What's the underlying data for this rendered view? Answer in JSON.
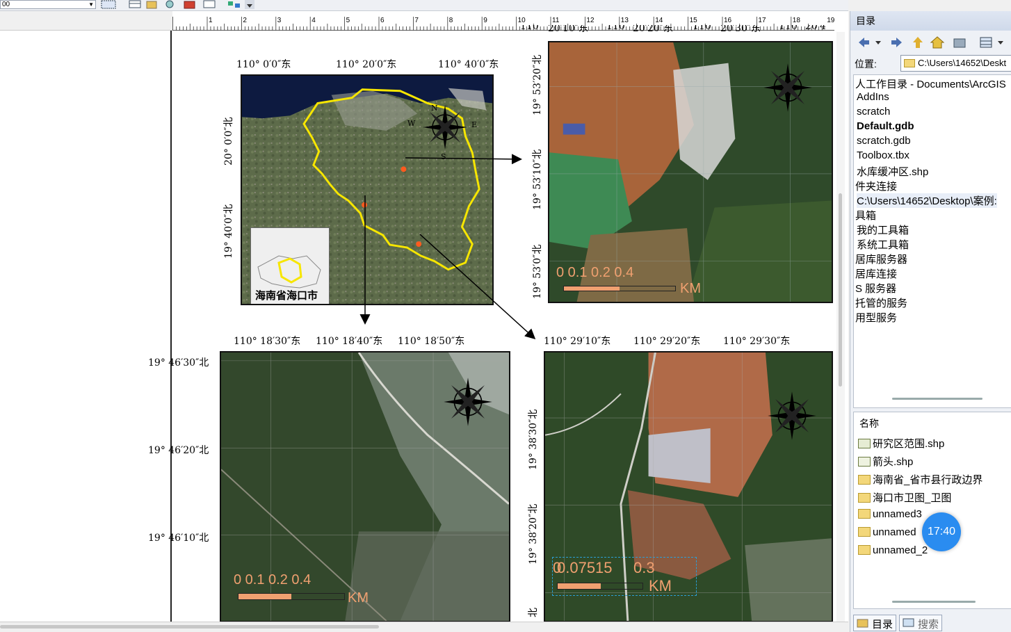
{
  "toolbar": {
    "zoom_value": "00"
  },
  "ruler": {
    "ticks": [
      "1",
      "2",
      "3",
      "4",
      "5",
      "6",
      "7",
      "8",
      "9",
      "10",
      "11",
      "12",
      "13",
      "14",
      "15",
      "16",
      "17",
      "18",
      "19"
    ]
  },
  "map_overview": {
    "top_labels": [
      "110° 0′0″东",
      "110° 20′0″东",
      "110° 40′0″东"
    ],
    "left_labels": [
      "20° 0′0″北",
      "19° 40′0″北"
    ],
    "inset_label": "海南省海口市",
    "compass": {
      "n": "N",
      "e": "E",
      "s": "S",
      "w": "W"
    }
  },
  "map_tr": {
    "top_labels": [
      "110",
      "20′10″东",
      "110",
      "20′20″东",
      "110",
      "20′30″东",
      "110",
      "20′4"
    ],
    "left_labels": [
      "19° 53′20″北",
      "19° 53′10″北",
      "19° 53′0″北"
    ],
    "scale_numbers": "0  0.1 0.2       0.4",
    "scale_unit": "KM"
  },
  "map_bl": {
    "top_labels": [
      "110° 18′30″东",
      "110° 18′40″东",
      "110° 18′50″东"
    ],
    "left_labels": [
      "19° 46′30″北",
      "19° 46′20″北",
      "19° 46′10″北"
    ],
    "scale_numbers": "0  0.1 0.2       0.4",
    "scale_unit": "KM"
  },
  "map_br": {
    "top_labels": [
      "110° 29′10″东",
      "110° 29′20″东",
      "110° 29′30″东"
    ],
    "left_labels": [
      "19° 38′30″北",
      "19° 38′20″北",
      "北"
    ],
    "scale_numbers": "0.07515",
    "scale_num_lead": "0",
    "scale_num_tail": "0.3",
    "scale_unit": "KM"
  },
  "catalog": {
    "title": "目录",
    "location_label": "位置:",
    "location_value": "C:\\Users\\14652\\Deskt",
    "tree_items": [
      {
        "label": "人工作目录 - Documents\\ArcGIS"
      },
      {
        "label": "AddIns"
      },
      {
        "label": "scratch"
      },
      {
        "label": "Default.gdb"
      },
      {
        "label": "scratch.gdb"
      },
      {
        "label": "Toolbox.tbx"
      },
      {
        "label": "水库缓冲区.shp"
      },
      {
        "label": "件夹连接"
      },
      {
        "label": "C:\\Users\\14652\\Desktop\\案例:"
      },
      {
        "label": "具箱"
      },
      {
        "label": "我的工具箱"
      },
      {
        "label": "系统工具箱"
      },
      {
        "label": "居库服务器"
      },
      {
        "label": "居库连接"
      },
      {
        "label": "S 服务器"
      },
      {
        "label": "托管的服务"
      },
      {
        "label": "用型服务"
      }
    ],
    "list_header": "名称",
    "list_items": [
      {
        "label": "研究区范围.shp"
      },
      {
        "label": "箭头.shp"
      },
      {
        "label": "海南省_省市县行政边界"
      },
      {
        "label": "海口市卫图_卫图"
      },
      {
        "label": "unnamed3"
      },
      {
        "label": "unnamed"
      },
      {
        "label": "unnamed_2"
      }
    ],
    "tabs": {
      "catalog": "目录",
      "search": "搜索"
    }
  },
  "overlay": {
    "time": "17:40"
  },
  "colors": {
    "boundary": "#f7e600",
    "scale": "#f0a070",
    "panel": "#eef1f6"
  }
}
